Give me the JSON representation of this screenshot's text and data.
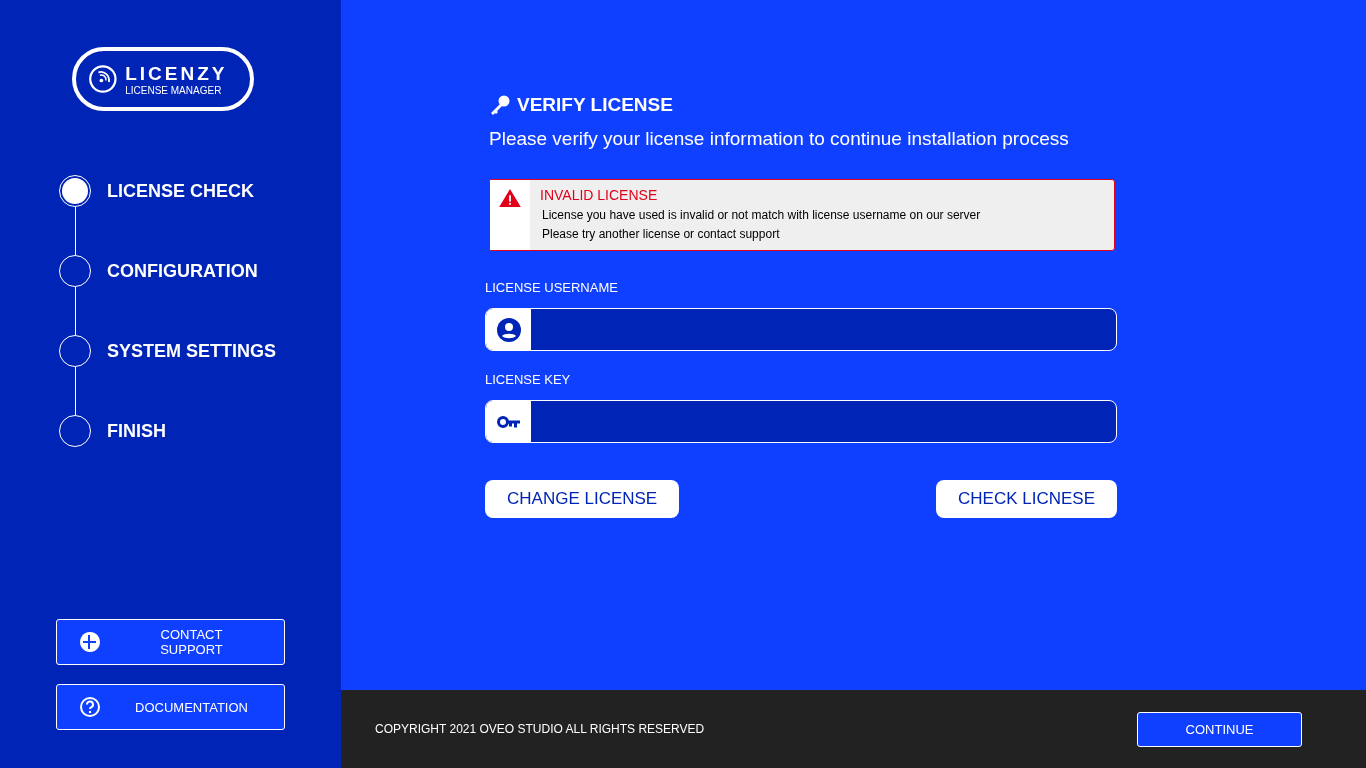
{
  "logo": {
    "name": "LICENZY",
    "subtitle": "LICENSE MANAGER"
  },
  "steps": [
    {
      "label": "LICENSE CHECK",
      "selected": true
    },
    {
      "label": "CONFIGURATION",
      "selected": false
    },
    {
      "label": "SYSTEM SETTINGS",
      "selected": false
    },
    {
      "label": "FINISH",
      "selected": false
    }
  ],
  "sidebar_buttons": [
    {
      "kind": "support",
      "label": "CONTACT SUPPORT"
    },
    {
      "kind": "help",
      "label": "DOCUMENTATION"
    }
  ],
  "heading": "VERIFY LICENSE",
  "subheading": "Please verify your license information to continue installation process",
  "alert": {
    "title": "INVALID LICENSE",
    "lines": [
      "License you have used is invalid or not match with license username on our server",
      "Please try another license or contact support"
    ]
  },
  "fields": [
    {
      "kind": "user",
      "label": "LICENSE USERNAME"
    },
    {
      "kind": "key",
      "label": "LICENSE KEY"
    }
  ],
  "actions": [
    "CHANGE LICENSE",
    "CHECK LICNESE"
  ],
  "footer": {
    "copyright": "COPYRIGHT 2021 OVEO STUDIO ALL RIGHTS RESERVED",
    "button": "CONTINUE"
  }
}
